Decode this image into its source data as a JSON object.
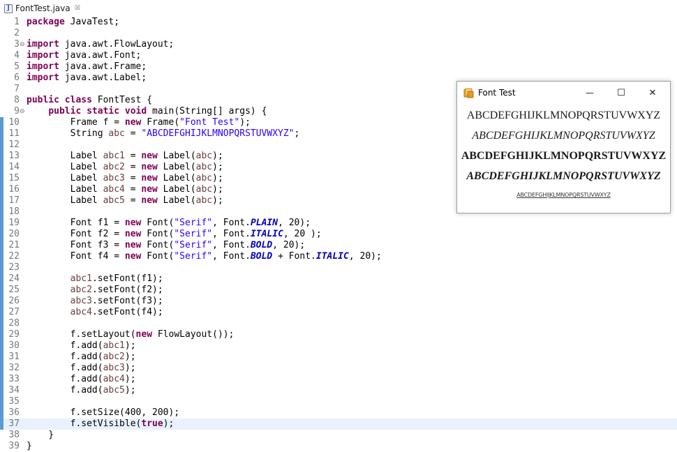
{
  "tab": {
    "title": "FontTest.java",
    "close_glyph": "☒"
  },
  "editor": {
    "current_line": 37,
    "changed_lines": [
      10,
      11,
      12,
      13,
      14,
      15,
      16,
      17,
      18,
      19,
      20,
      21,
      22,
      23,
      24,
      25,
      26,
      27,
      28,
      29,
      30,
      31,
      32,
      33,
      34,
      35,
      36,
      37
    ],
    "folds": {
      "3": "⊖",
      "9": "⊖"
    },
    "lines": [
      [
        [
          "kw",
          "package"
        ],
        [
          "pl",
          " JavaTest;"
        ]
      ],
      [],
      [
        [
          "kw",
          "import"
        ],
        [
          "pl",
          " java.awt.FlowLayout;"
        ]
      ],
      [
        [
          "kw",
          "import"
        ],
        [
          "pl",
          " java.awt.Font;"
        ]
      ],
      [
        [
          "kw",
          "import"
        ],
        [
          "pl",
          " java.awt.Frame;"
        ]
      ],
      [
        [
          "kw",
          "import"
        ],
        [
          "pl",
          " java.awt.Label;"
        ]
      ],
      [],
      [
        [
          "kw",
          "public class"
        ],
        [
          "pl",
          " FontTest {"
        ]
      ],
      [
        [
          "pl",
          "    "
        ],
        [
          "kw",
          "public static void"
        ],
        [
          "pl",
          " main(String[] args) {"
        ]
      ],
      [
        [
          "pl",
          "        Frame f = "
        ],
        [
          "kw",
          "new"
        ],
        [
          "pl",
          " Frame("
        ],
        [
          "str",
          "\"Font Test\""
        ],
        [
          "pl",
          ");"
        ]
      ],
      [
        [
          "pl",
          "        String "
        ],
        [
          "var",
          "abc"
        ],
        [
          "pl",
          " = "
        ],
        [
          "str",
          "\"ABCDEFGHIJKLMNOPQRSTUVWXYZ\""
        ],
        [
          "pl",
          ";"
        ]
      ],
      [],
      [
        [
          "pl",
          "        Label "
        ],
        [
          "var",
          "abc1"
        ],
        [
          "pl",
          " = "
        ],
        [
          "kw",
          "new"
        ],
        [
          "pl",
          " Label("
        ],
        [
          "var",
          "abc"
        ],
        [
          "pl",
          ");"
        ]
      ],
      [
        [
          "pl",
          "        Label "
        ],
        [
          "var",
          "abc2"
        ],
        [
          "pl",
          " = "
        ],
        [
          "kw",
          "new"
        ],
        [
          "pl",
          " Label("
        ],
        [
          "var",
          "abc"
        ],
        [
          "pl",
          ");"
        ]
      ],
      [
        [
          "pl",
          "        Label "
        ],
        [
          "var",
          "abc3"
        ],
        [
          "pl",
          " = "
        ],
        [
          "kw",
          "new"
        ],
        [
          "pl",
          " Label("
        ],
        [
          "var",
          "abc"
        ],
        [
          "pl",
          ");"
        ]
      ],
      [
        [
          "pl",
          "        Label "
        ],
        [
          "var",
          "abc4"
        ],
        [
          "pl",
          " = "
        ],
        [
          "kw",
          "new"
        ],
        [
          "pl",
          " Label("
        ],
        [
          "var",
          "abc"
        ],
        [
          "pl",
          ");"
        ]
      ],
      [
        [
          "pl",
          "        Label "
        ],
        [
          "var",
          "abc5"
        ],
        [
          "pl",
          " = "
        ],
        [
          "kw",
          "new"
        ],
        [
          "pl",
          " Label("
        ],
        [
          "var",
          "abc"
        ],
        [
          "pl",
          ");"
        ]
      ],
      [],
      [
        [
          "pl",
          "        Font f1 = "
        ],
        [
          "kw",
          "new"
        ],
        [
          "pl",
          " Font("
        ],
        [
          "str",
          "\"Serif\""
        ],
        [
          "pl",
          ", Font."
        ],
        [
          "fld",
          "PLAIN"
        ],
        [
          "pl",
          ", 20);"
        ]
      ],
      [
        [
          "pl",
          "        Font f2 = "
        ],
        [
          "kw",
          "new"
        ],
        [
          "pl",
          " Font("
        ],
        [
          "str",
          "\"Serif\""
        ],
        [
          "pl",
          ", Font."
        ],
        [
          "fld",
          "ITALIC"
        ],
        [
          "pl",
          ", 20 );"
        ]
      ],
      [
        [
          "pl",
          "        Font f3 = "
        ],
        [
          "kw",
          "new"
        ],
        [
          "pl",
          " Font("
        ],
        [
          "str",
          "\"Serif\""
        ],
        [
          "pl",
          ", Font."
        ],
        [
          "fld",
          "BOLD"
        ],
        [
          "pl",
          ", 20);"
        ]
      ],
      [
        [
          "pl",
          "        Font f4 = "
        ],
        [
          "kw",
          "new"
        ],
        [
          "pl",
          " Font("
        ],
        [
          "str",
          "\"Serif\""
        ],
        [
          "pl",
          ", Font."
        ],
        [
          "fld",
          "BOLD"
        ],
        [
          "pl",
          " + Font."
        ],
        [
          "fld",
          "ITALIC"
        ],
        [
          "pl",
          ", 20);"
        ]
      ],
      [],
      [
        [
          "pl",
          "        "
        ],
        [
          "var",
          "abc1"
        ],
        [
          "pl",
          ".setFont(f1);"
        ]
      ],
      [
        [
          "pl",
          "        "
        ],
        [
          "var",
          "abc2"
        ],
        [
          "pl",
          ".setFont(f2);"
        ]
      ],
      [
        [
          "pl",
          "        "
        ],
        [
          "var",
          "abc3"
        ],
        [
          "pl",
          ".setFont(f3);"
        ]
      ],
      [
        [
          "pl",
          "        "
        ],
        [
          "var",
          "abc4"
        ],
        [
          "pl",
          ".setFont(f4);"
        ]
      ],
      [],
      [
        [
          "pl",
          "        f.setLayout("
        ],
        [
          "kw",
          "new"
        ],
        [
          "pl",
          " FlowLayout());"
        ]
      ],
      [
        [
          "pl",
          "        f.add("
        ],
        [
          "var",
          "abc1"
        ],
        [
          "pl",
          ");"
        ]
      ],
      [
        [
          "pl",
          "        f.add("
        ],
        [
          "var",
          "abc2"
        ],
        [
          "pl",
          ");"
        ]
      ],
      [
        [
          "pl",
          "        f.add("
        ],
        [
          "var",
          "abc3"
        ],
        [
          "pl",
          ");"
        ]
      ],
      [
        [
          "pl",
          "        f.add("
        ],
        [
          "var",
          "abc4"
        ],
        [
          "pl",
          ");"
        ]
      ],
      [
        [
          "pl",
          "        f.add("
        ],
        [
          "var",
          "abc5"
        ],
        [
          "pl",
          ");"
        ]
      ],
      [],
      [
        [
          "pl",
          "        f.setSize(400, 200);"
        ]
      ],
      [
        [
          "pl",
          "        f.setVisible("
        ],
        [
          "kw",
          "true"
        ],
        [
          "pl",
          ");"
        ]
      ],
      [
        [
          "pl",
          "    }"
        ]
      ],
      [
        [
          "pl",
          "}"
        ]
      ]
    ]
  },
  "window": {
    "title": "Font Test",
    "min_glyph": "—",
    "max_glyph": "☐",
    "close_glyph": "✕",
    "labels": [
      "ABCDEFGHIJKLMNOPQRSTUVWXYZ",
      "ABCDEFGHIJKLMNOPQRSTUVWXYZ",
      "ABCDEFGHIJKLMNOPQRSTUVWXYZ",
      "ABCDEFGHIJKLMNOPQRSTUVWXYZ",
      "ABCDEFGHIJKLMNOPQRSTUVWXYZ"
    ]
  },
  "colors": {
    "keyword": "#7f0055",
    "string": "#2a00ff",
    "static_field": "#0000c0",
    "local_variable": "#6a3e3e",
    "change_bar": "#5b9bd5",
    "current_line": "#e8f2fe"
  }
}
